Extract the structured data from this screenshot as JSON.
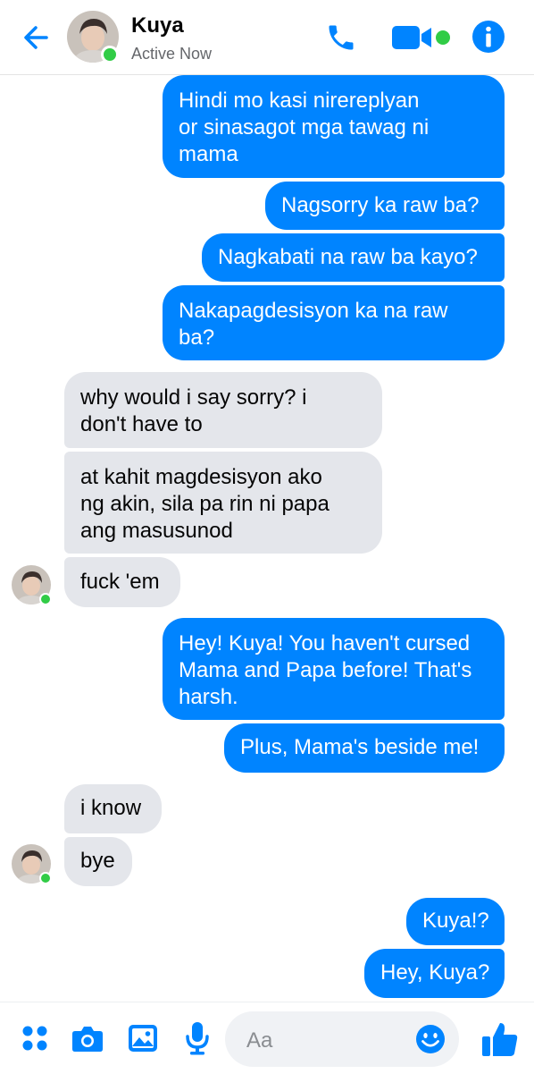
{
  "header": {
    "contact_name": "Kuya",
    "status": "Active Now",
    "icons": [
      "back-arrow-icon",
      "avatar",
      "phone-icon",
      "video-call-icon",
      "info-icon"
    ]
  },
  "messages": [
    {
      "side": "out",
      "lines": [
        "Hindi mo kasi nirereplyan",
        "or sinasagot mga tawag ni",
        "mama"
      ]
    },
    {
      "side": "out",
      "lines": [
        "Nagsorry ka raw ba?"
      ]
    },
    {
      "side": "out",
      "lines": [
        "Nagkabati na raw ba kayo?"
      ]
    },
    {
      "side": "out",
      "lines": [
        "Nakapagdesisyon ka na raw",
        "ba?"
      ]
    },
    {
      "side": "in",
      "lines": [
        "why would i say sorry? i",
        "don't have to"
      ]
    },
    {
      "side": "in",
      "lines": [
        "at kahit magdesisyon ako",
        "ng akin, sila pa rin ni papa",
        "ang masusunod"
      ]
    },
    {
      "side": "in",
      "lines": [
        "fuck 'em"
      ]
    },
    {
      "side": "out",
      "lines": [
        "Hey! Kuya! You haven't cursed",
        "Mama and Papa before! That's",
        "harsh."
      ]
    },
    {
      "side": "out",
      "lines": [
        "Plus, Mama's beside me!"
      ]
    },
    {
      "side": "in",
      "lines": [
        "i know"
      ]
    },
    {
      "side": "in",
      "lines": [
        "bye"
      ]
    },
    {
      "side": "out",
      "lines": [
        "Kuya!?"
      ]
    },
    {
      "side": "out",
      "lines": [
        "Hey, Kuya?"
      ]
    }
  ],
  "composer": {
    "placeholder": "Aa",
    "icons": [
      "apps-icon",
      "camera-icon",
      "gallery-icon",
      "microphone-icon",
      "emoji-icon",
      "like-thumb-icon"
    ]
  },
  "colors": {
    "accent": "#0084ff",
    "incoming": "#e4e6eb",
    "online": "#31cc46"
  }
}
